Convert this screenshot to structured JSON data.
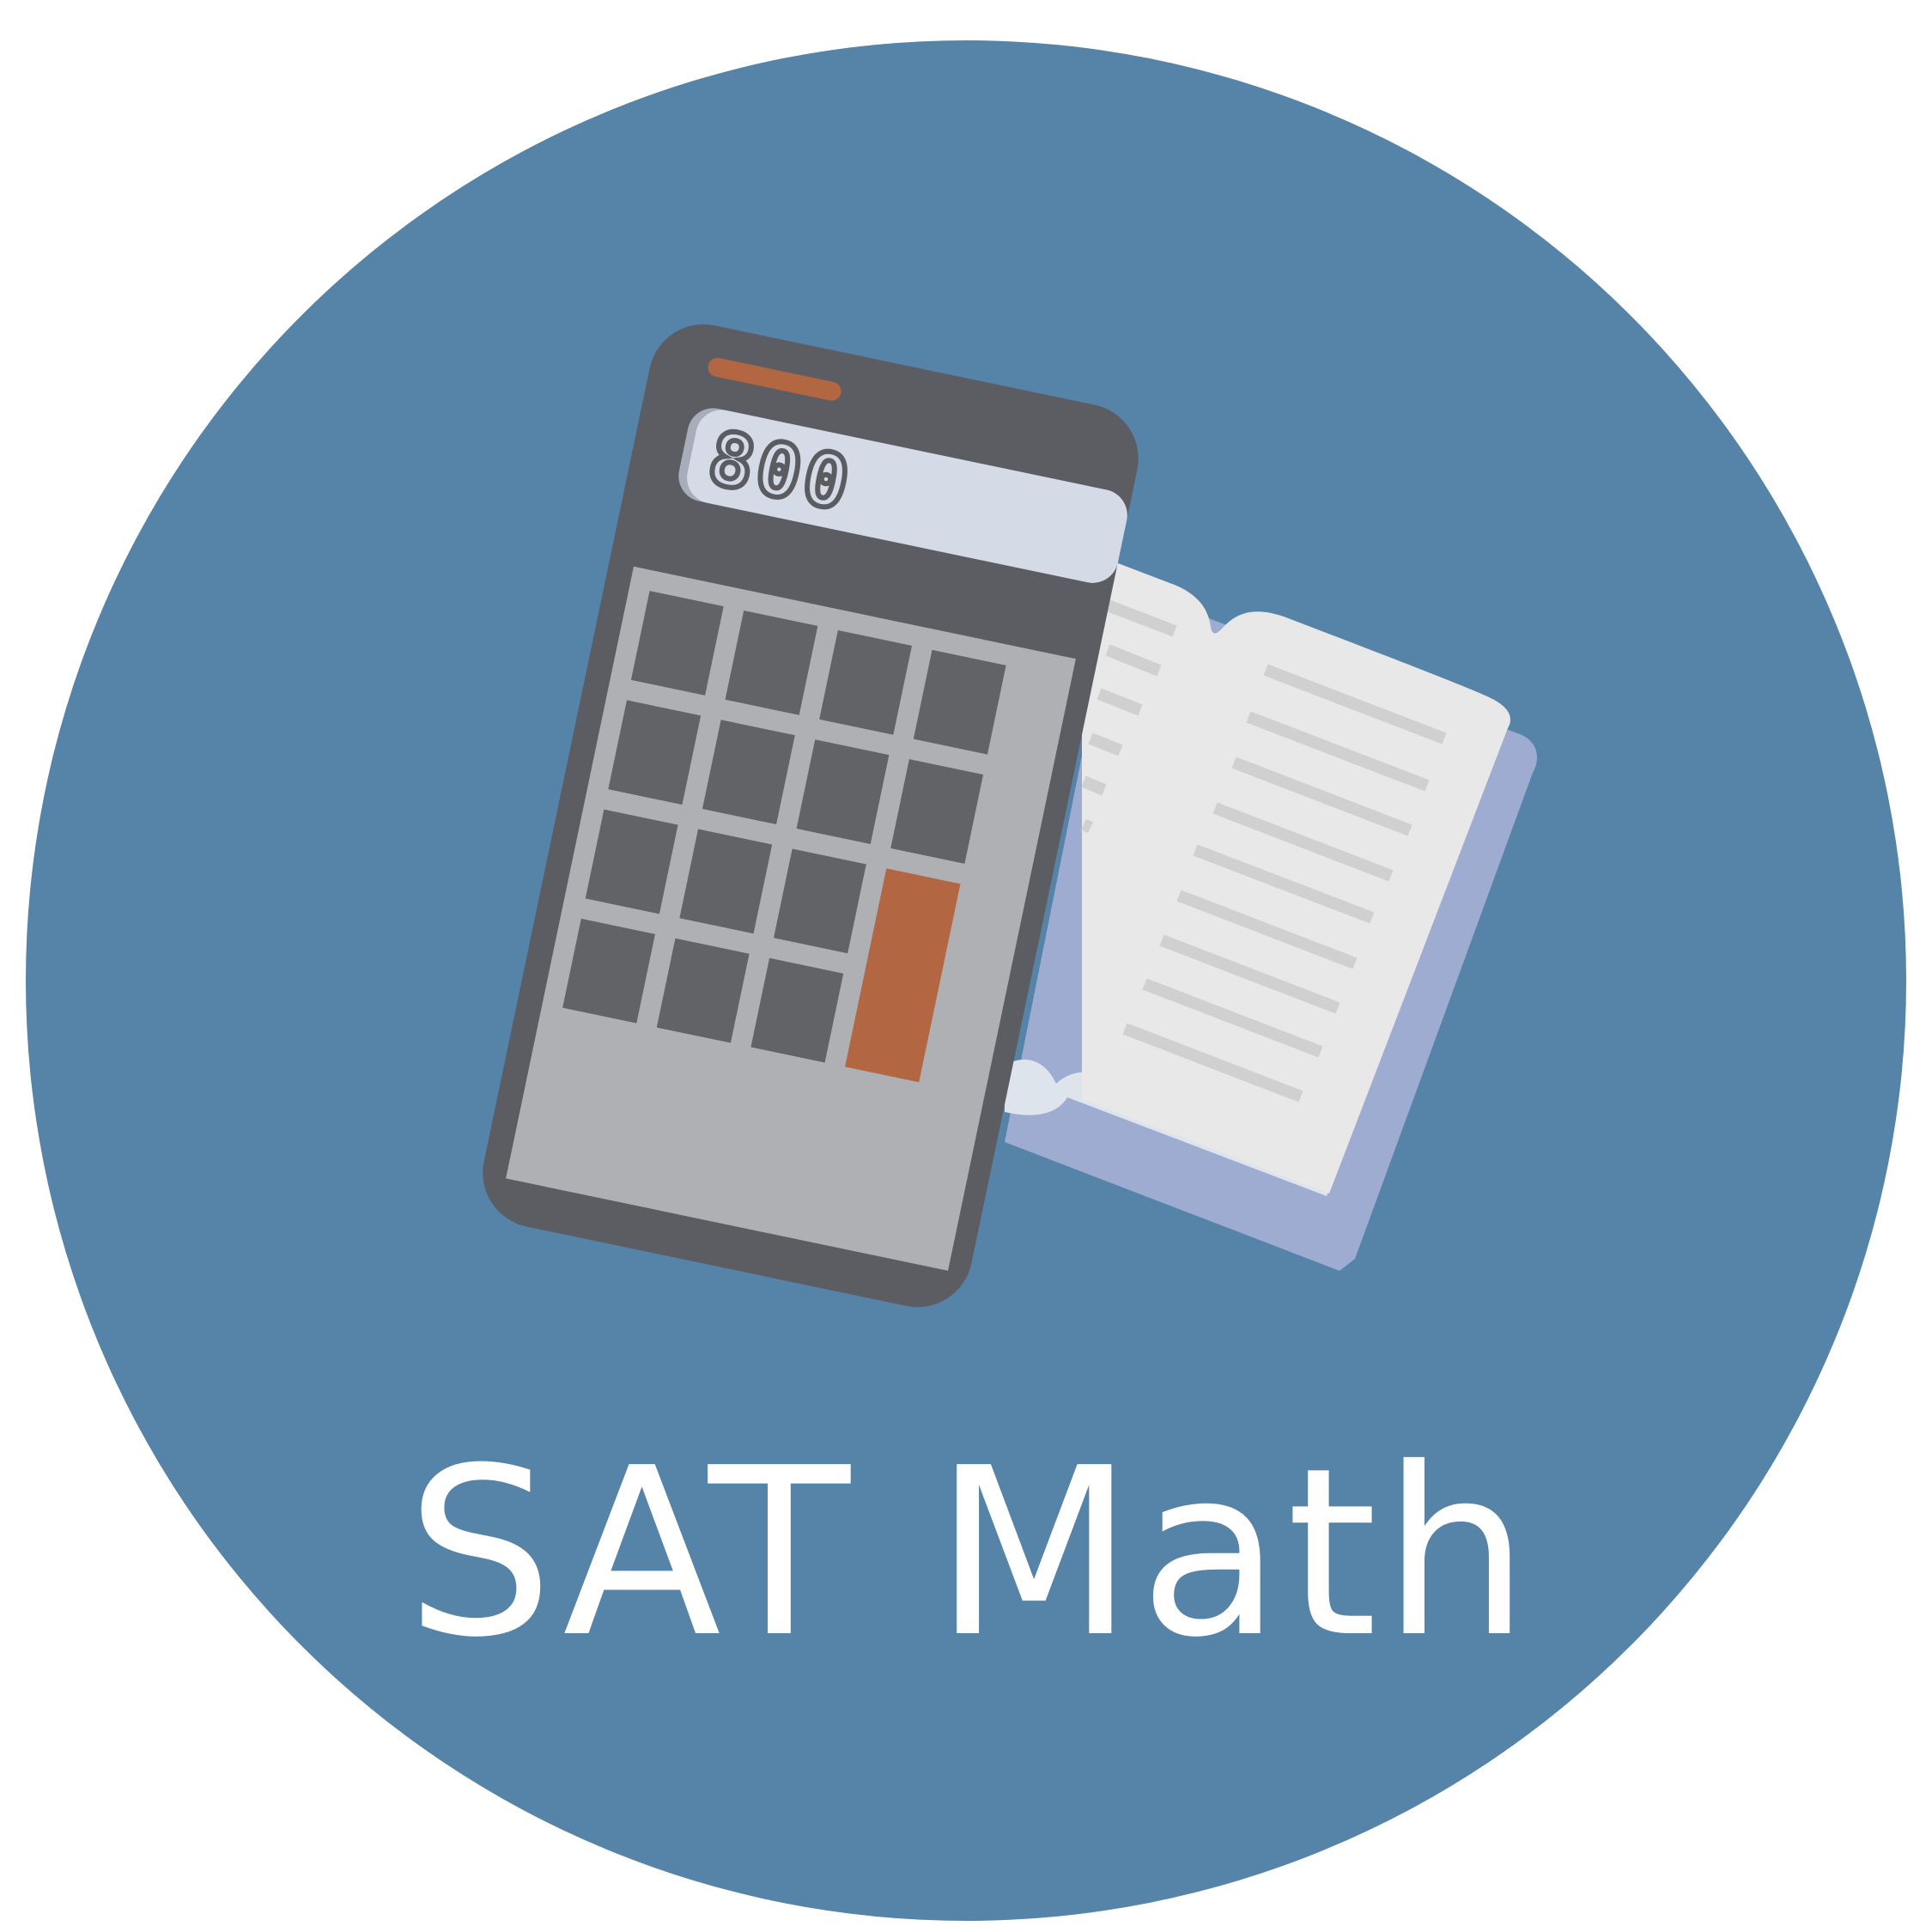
{
  "badge": {
    "title": "SAT Math",
    "display_value": "800",
    "icons": {
      "calculator": "calculator-icon",
      "book": "open-book-icon"
    },
    "colors": {
      "circle": "#5683a8",
      "calculator_body": "#5c5d62",
      "keypad_panel": "#afb0b3",
      "key": "#626366",
      "accent_key": "#b26642",
      "lcd_screen": "#d4dae6",
      "book_page": "#e8e8e8",
      "book_cover": "#9dacd0",
      "page_lines": "#d0d0d0",
      "text": "#ffffff"
    }
  }
}
